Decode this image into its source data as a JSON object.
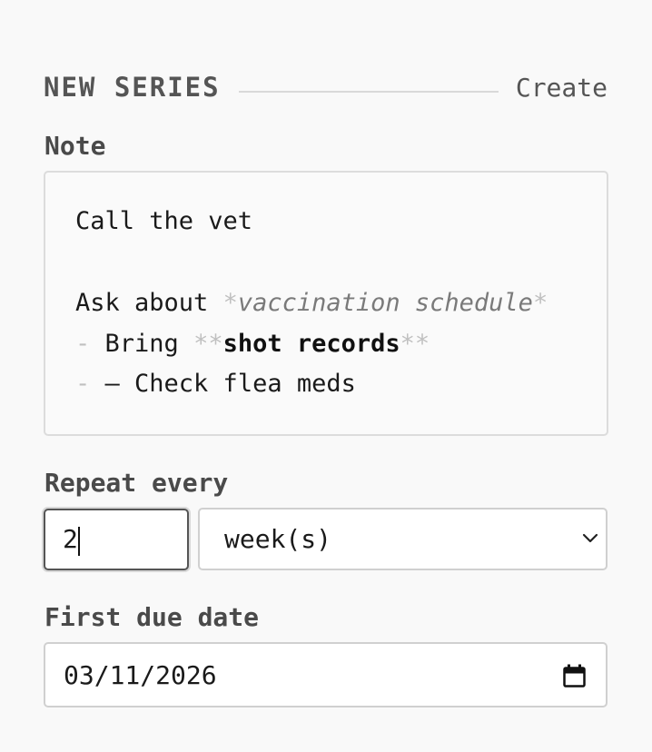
{
  "header": {
    "title": "NEW SERIES",
    "create_label": "Create"
  },
  "note": {
    "label": "Note",
    "lines": [
      {
        "text": "Call the vet"
      },
      {
        "text": ""
      },
      {
        "prefix": "Ask about ",
        "em_open": "*",
        "em": "vaccination schedule",
        "em_close": "*"
      },
      {
        "marker": "- ",
        "prefix": "Bring ",
        "strong_open": "**",
        "strong": "shot records",
        "strong_close": "**"
      },
      {
        "marker": "- ",
        "text": "– Check flea meds"
      }
    ]
  },
  "repeat": {
    "label": "Repeat every",
    "interval_value": "2",
    "unit_selected": "week(s)"
  },
  "first_due": {
    "label": "First due date",
    "value": "03/11/2026"
  },
  "icons": {
    "select_arrow": "chevron-down-icon",
    "date_picker": "calendar-icon"
  }
}
